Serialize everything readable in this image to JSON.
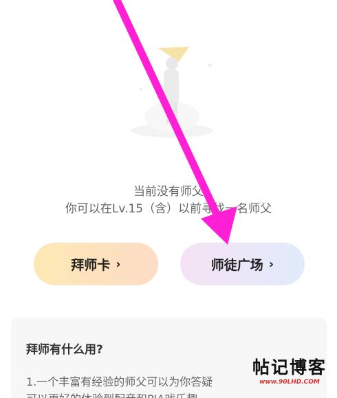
{
  "empty_state": {
    "line1": "当前没有师父",
    "line2": "你可以在Lv.15（含）以前寻找一名师父"
  },
  "buttons": {
    "apprentice_card": "拜师卡",
    "mentor_plaza": "师徒广场",
    "chevron": "›"
  },
  "info": {
    "title": "拜师有什么用?",
    "line1": "1.一个丰富有经验的师父可以为你答疑",
    "line2": "可以更好的体验到配音和PIA戏乐趣"
  },
  "watermark": {
    "title": "帖记博客",
    "url": "www.90LHD.COM"
  },
  "colors": {
    "arrow": "#ff1fd4",
    "hat": "#f6e3a8"
  }
}
